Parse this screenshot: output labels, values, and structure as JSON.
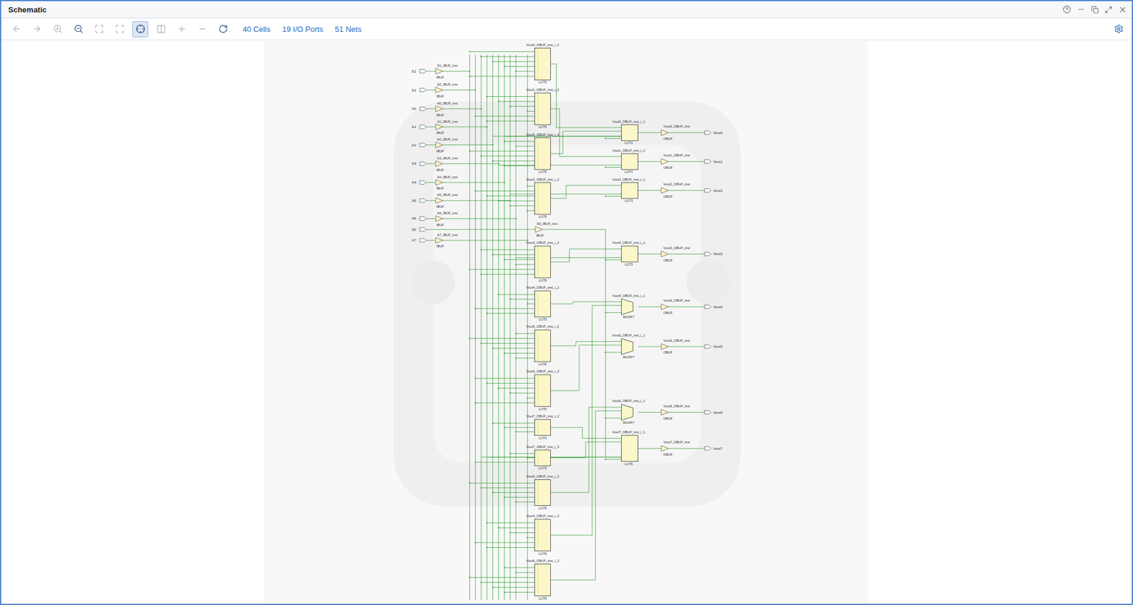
{
  "window": {
    "title": "Schematic"
  },
  "toolbar": {
    "tools": [
      {
        "disabled": true,
        "selected": false
      },
      {
        "disabled": true,
        "selected": false
      },
      {
        "disabled": true,
        "selected": false
      },
      {
        "disabled": false,
        "selected": false
      },
      {
        "disabled": true,
        "selected": false
      },
      {
        "disabled": true,
        "selected": false
      },
      {
        "disabled": false,
        "selected": true
      },
      {
        "disabled": true,
        "selected": false
      },
      {
        "disabled": true,
        "selected": false
      },
      {
        "disabled": true,
        "selected": false
      },
      {
        "disabled": false,
        "selected": false
      }
    ],
    "stats": [
      "40 Cells",
      "19 I/O Ports",
      "51 Nets"
    ]
  },
  "schematic": {
    "inputs": [
      {
        "port": "S1",
        "buffer": "S1_IBUF_inst",
        "type": "IBUF"
      },
      {
        "port": "S2",
        "buffer": "S2_IBUF_inst",
        "type": "IBUF"
      },
      {
        "port": "A0",
        "buffer": "A0_IBUF_inst",
        "type": "IBUF"
      },
      {
        "port": "A1",
        "buffer": "A1_IBUF_inst",
        "type": "IBUF"
      },
      {
        "port": "A2",
        "buffer": "A2_IBUF_inst",
        "type": "IBUF"
      },
      {
        "port": "A3",
        "buffer": "A3_IBUF_inst",
        "type": "IBUF"
      },
      {
        "port": "A4",
        "buffer": "A4_IBUF_inst",
        "type": "IBUF"
      },
      {
        "port": "A5",
        "buffer": "A5_IBUF_inst",
        "type": "IBUF"
      },
      {
        "port": "A6",
        "buffer": "A6_IBUF_inst",
        "type": "IBUF"
      },
      {
        "port": "S0",
        "buffer": "S0_IBUF_inst",
        "type": "IBUF"
      },
      {
        "port": "A7",
        "buffer": "A7_IBUF_inst",
        "type": "IBUF"
      }
    ],
    "luts": [
      {
        "name": "Vout0_OBUF_inst_i_2",
        "type": "LUT6"
      },
      {
        "name": "Vout1_OBUF_inst_i_2",
        "type": "LUT6"
      },
      {
        "name": "Vout0_OBUF_inst_i_3",
        "type": "LUT6"
      },
      {
        "name": "Vout2_OBUF_inst_i_2",
        "type": "LUT6"
      },
      {
        "name": "Vout3_OBUF_inst_i_2",
        "type": "LUT6"
      },
      {
        "name": "Vout4_OBUF_inst_i_2",
        "type": "LUT5"
      },
      {
        "name": "Vout5_OBUF_inst_i_2",
        "type": "LUT6"
      },
      {
        "name": "Vout5_OBUF_inst_i_3",
        "type": "LUT6"
      },
      {
        "name": "Vout7_OBUF_inst_i_2",
        "type": "LUT3"
      },
      {
        "name": "Vout7_OBUF_inst_i_3",
        "type": "LUT3"
      },
      {
        "name": "Vout6_OBUF_inst_i_2",
        "type": "LUT5"
      },
      {
        "name": "Vout4_OBUF_inst_i_3",
        "type": "LUT6"
      },
      {
        "name": "Vout6_OBUF_inst_i_3",
        "type": "LUT6"
      }
    ],
    "stage2": [
      {
        "name": "Vout0_OBUF_inst_i_1",
        "type": "LUT3",
        "kind": "lut"
      },
      {
        "name": "Vout1_OBUF_inst_i_1",
        "type": "LUT3",
        "kind": "lut"
      },
      {
        "name": "Vout2_OBUF_inst_i_1",
        "type": "LUT3",
        "kind": "lut"
      },
      {
        "name": "Vout3_OBUF_inst_i_1",
        "type": "LUT3",
        "kind": "lut"
      },
      {
        "name": "Vout4_OBUF_inst_i_1",
        "type": "MUXF7",
        "kind": "mux"
      },
      {
        "name": "Vout5_OBUF_inst_i_1",
        "type": "MUXF7",
        "kind": "mux"
      },
      {
        "name": "Vout6_OBUF_inst_i_1",
        "type": "MUXF7",
        "kind": "mux"
      },
      {
        "name": "Vout7_OBUF_inst_i_1",
        "type": "LUT5",
        "kind": "lut"
      }
    ],
    "outputs": [
      {
        "buffer": "Vout0_OBUF_inst",
        "type": "OBUF",
        "port": "Vout0"
      },
      {
        "buffer": "Vout1_OBUF_inst",
        "type": "OBUF",
        "port": "Vout1"
      },
      {
        "buffer": "Vout2_OBUF_inst",
        "type": "OBUF",
        "port": "Vout2"
      },
      {
        "buffer": "Vout3_OBUF_inst",
        "type": "OBUF",
        "port": "Vout3"
      },
      {
        "buffer": "Vout4_OBUF_inst",
        "type": "OBUF",
        "port": "Vout4"
      },
      {
        "buffer": "Vout5_OBUF_inst",
        "type": "OBUF",
        "port": "Vout5"
      },
      {
        "buffer": "Vout6_OBUF_inst",
        "type": "OBUF",
        "port": "Vout6"
      },
      {
        "buffer": "Vout7_OBUF_inst",
        "type": "OBUF",
        "port": "Vout7"
      }
    ]
  }
}
